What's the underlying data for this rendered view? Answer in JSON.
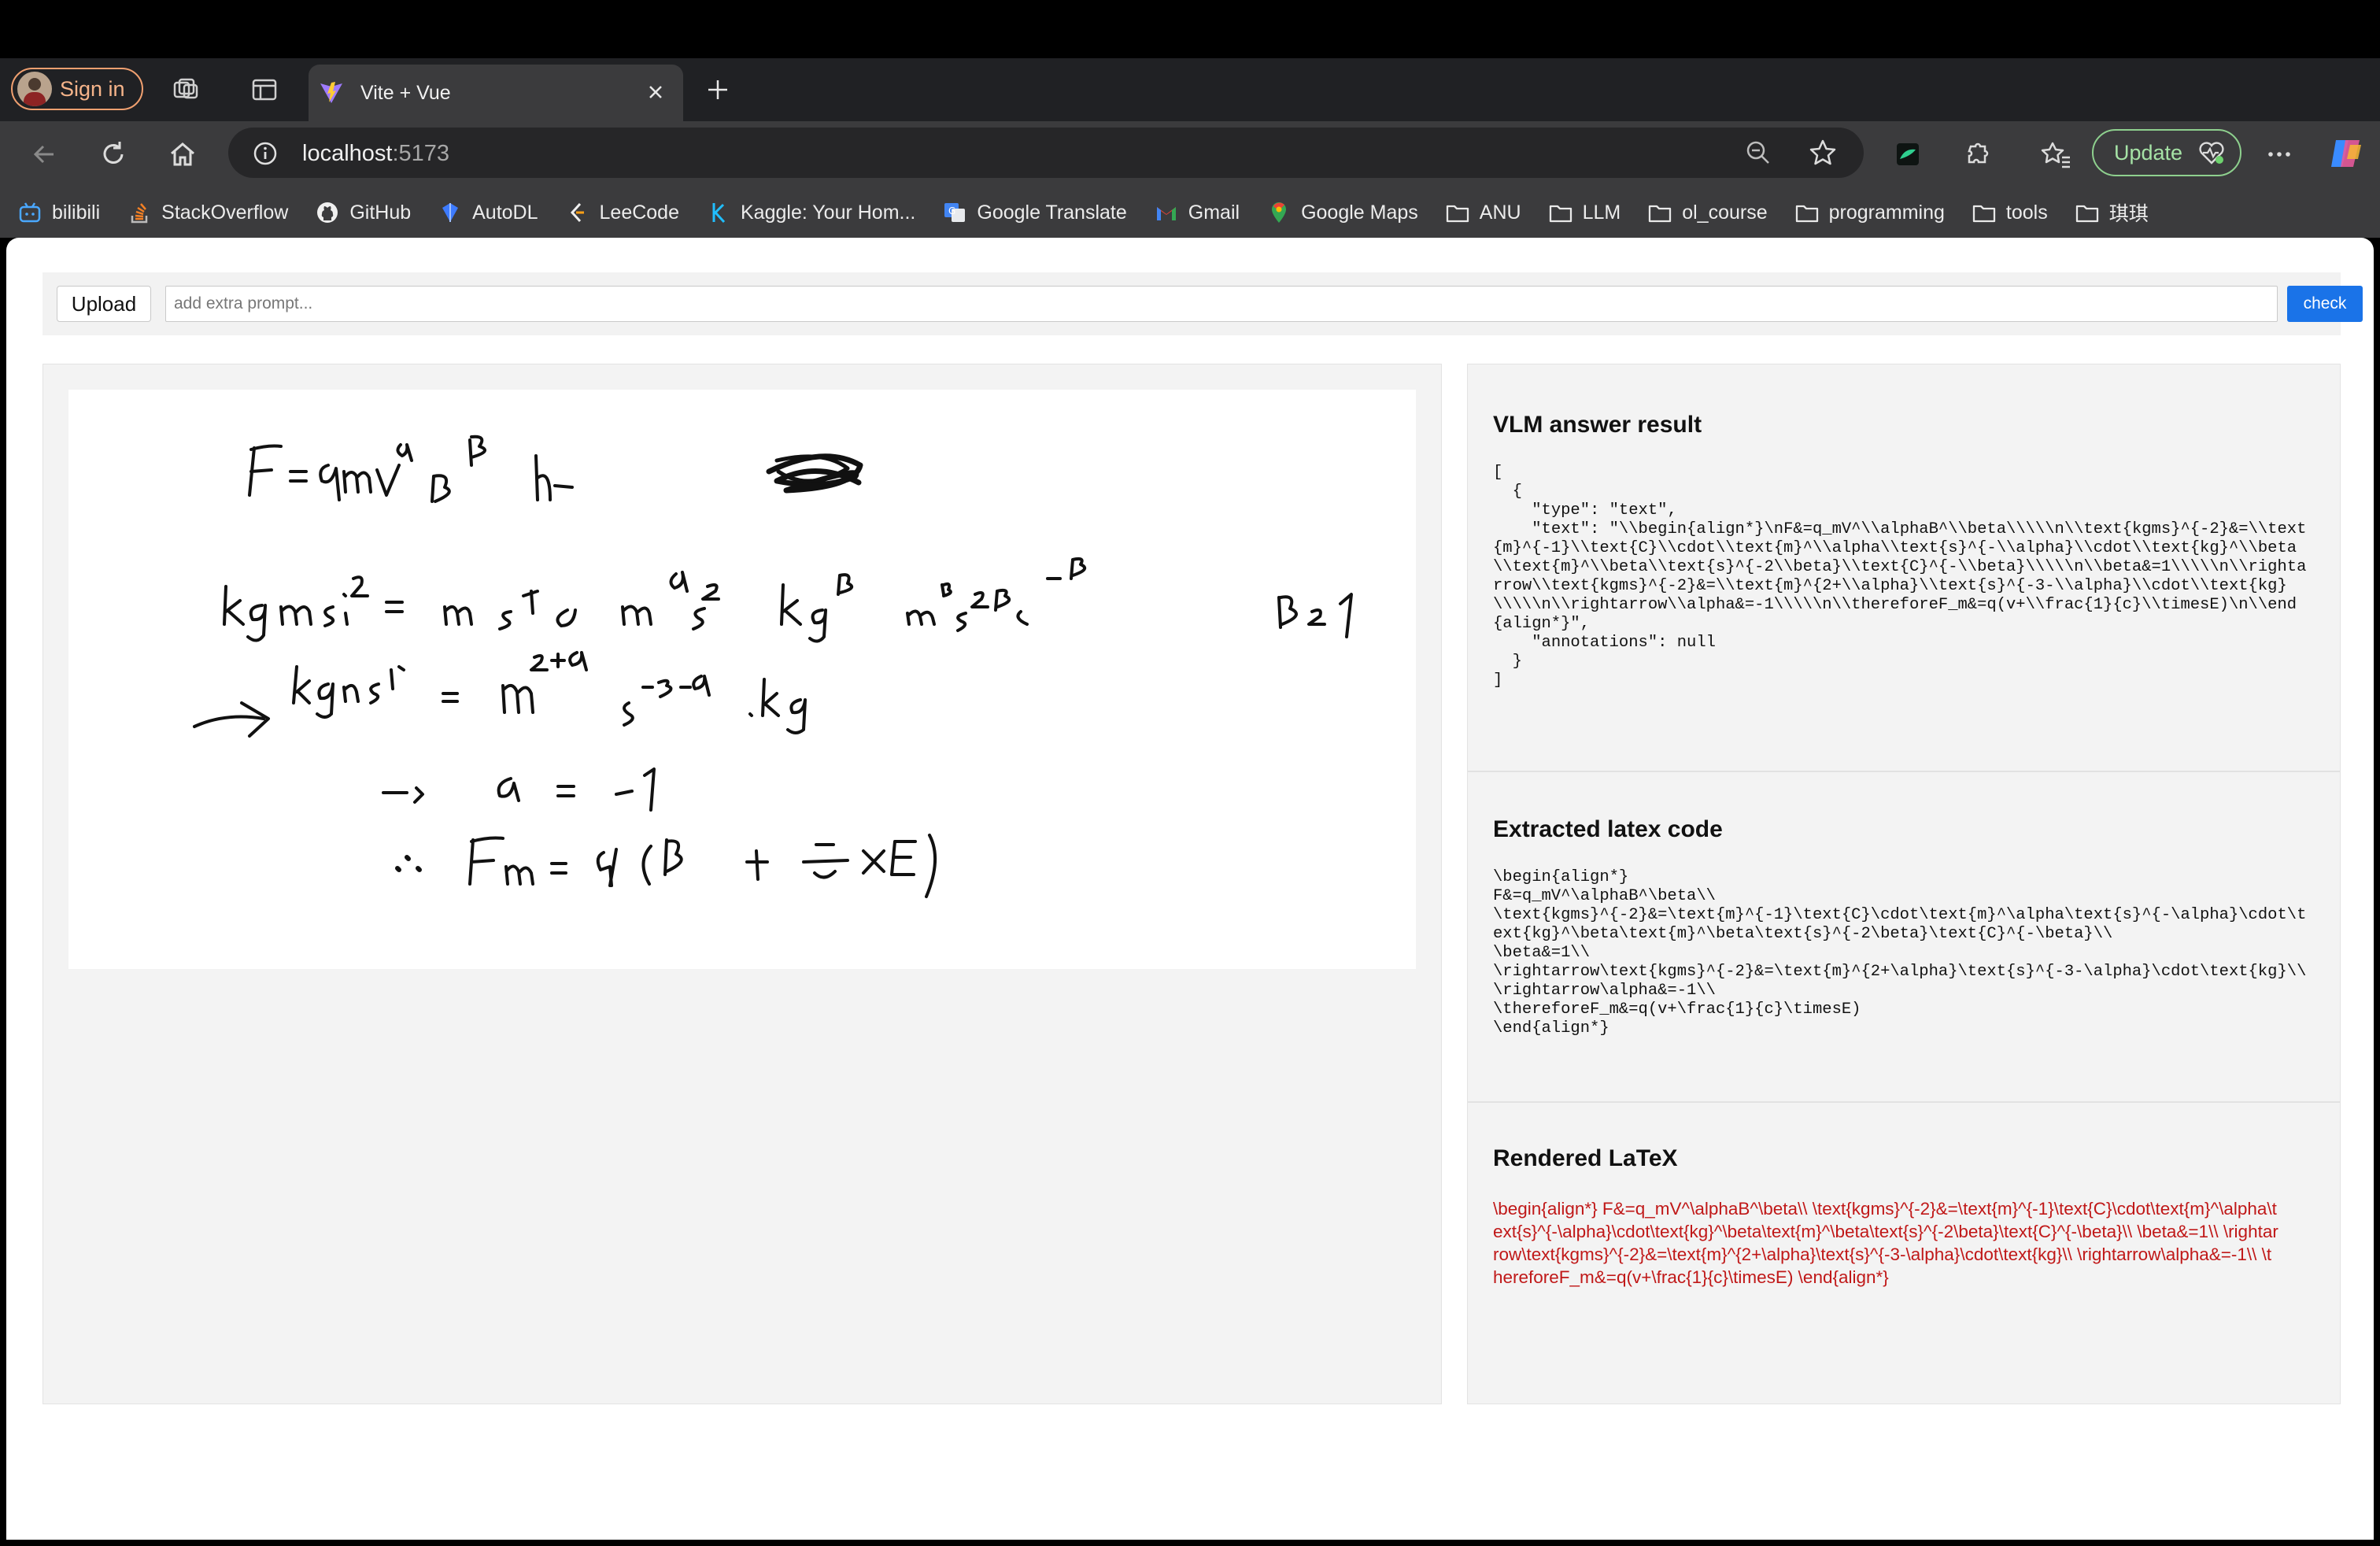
{
  "browser": {
    "signin_label": "Sign in",
    "tab_title": "Vite + Vue",
    "url_host": "localhost",
    "url_port": ":5173",
    "update_label": "Update",
    "bookmarks": [
      {
        "label": "bilibili",
        "icon": "bilibili-icon"
      },
      {
        "label": "StackOverflow",
        "icon": "stackoverflow-icon"
      },
      {
        "label": "GitHub",
        "icon": "github-icon"
      },
      {
        "label": "AutoDL",
        "icon": "autodl-icon"
      },
      {
        "label": "LeeCode",
        "icon": "leetcode-icon"
      },
      {
        "label": "Kaggle: Your Hom...",
        "icon": "kaggle-icon"
      },
      {
        "label": "Google Translate",
        "icon": "translate-icon"
      },
      {
        "label": "Gmail",
        "icon": "gmail-icon"
      },
      {
        "label": "Google Maps",
        "icon": "maps-icon"
      },
      {
        "label": "ANU",
        "icon": "folder-icon"
      },
      {
        "label": "LLM",
        "icon": "folder-icon"
      },
      {
        "label": "ol_course",
        "icon": "folder-icon"
      },
      {
        "label": "programming",
        "icon": "folder-icon"
      },
      {
        "label": "tools",
        "icon": "folder-icon"
      },
      {
        "label": "琪琪",
        "icon": "folder-icon"
      }
    ]
  },
  "app": {
    "upload_label": "Upload",
    "prompt_placeholder": "add extra prompt...",
    "check_label": "check",
    "accent_color": "#1a73e8",
    "render_color": "#c01818",
    "vlm": {
      "heading": "VLM answer result",
      "json_text": "[\n  {\n    \"type\": \"text\",\n    \"text\": \"\\\\begin{align*}\\nF&=q_mV^\\\\alphaB^\\\\beta\\\\\\\\\\n\\\\text{kgms}^{-2}&=\\\\text{m}^{-1}\\\\text{C}\\\\cdot\\\\text{m}^\\\\alpha\\\\text{s}^{-\\\\alpha}\\\\cdot\\\\text{kg}^\\\\beta\\\\text{m}^\\\\beta\\\\text{s}^{-2\\\\beta}\\\\text{C}^{-\\\\beta}\\\\\\\\\\n\\\\beta&=1\\\\\\\\\\n\\\\rightarrow\\\\text{kgms}^{-2}&=\\\\text{m}^{2+\\\\alpha}\\\\text{s}^{-3-\\\\alpha}\\\\cdot\\\\text{kg}\\\\\\\\\\n\\\\rightarrow\\\\alpha&=-1\\\\\\\\\\n\\\\thereforeF_m&=q(v+\\\\frac{1}{c}\\\\timesE)\\n\\\\end{align*}\",\n    \"annotations\": null\n  }\n]"
    },
    "latex": {
      "heading": "Extracted latex code",
      "code_text": "\\begin{align*}\nF&=q_mV^\\alphaB^\\beta\\\\\n\\text{kgms}^{-2}&=\\text{m}^{-1}\\text{C}\\cdot\\text{m}^\\alpha\\text{s}^{-\\alpha}\\cdot\\text{kg}^\\beta\\text{m}^\\beta\\text{s}^{-2\\beta}\\text{C}^{-\\beta}\\\\\n\\beta&=1\\\\\n\\rightarrow\\text{kgms}^{-2}&=\\text{m}^{2+\\alpha}\\text{s}^{-3-\\alpha}\\cdot\\text{kg}\\\\\n\\rightarrow\\alpha&=-1\\\\\n\\thereforeF_m&=q(v+\\frac{1}{c}\\timesE)\n\\end{align*}"
    },
    "rendered": {
      "heading": "Rendered LaTeX",
      "text": "\\begin{align*} F&=q_mV^\\alphaB^\\beta\\\\ \\text{kgms}^{-2}&=\\text{m}^{-1}\\text{C}\\cdot\\text{m}^\\alpha\\text{s}^{-\\alpha}\\cdot\\text{kg}^\\beta\\text{m}^\\beta\\text{s}^{-2\\beta}\\text{C}^{-\\beta}\\\\ \\beta&=1\\\\ \\rightarrow\\text{kgms}^{-2}&=\\text{m}^{2+\\alpha}\\text{s}^{-3-\\alpha}\\cdot\\text{kg}\\\\ \\rightarrow\\alpha&=-1\\\\ \\thereforeF_m&=q(v+\\frac{1}{c}\\timesE) \\end{align*}"
    }
  }
}
